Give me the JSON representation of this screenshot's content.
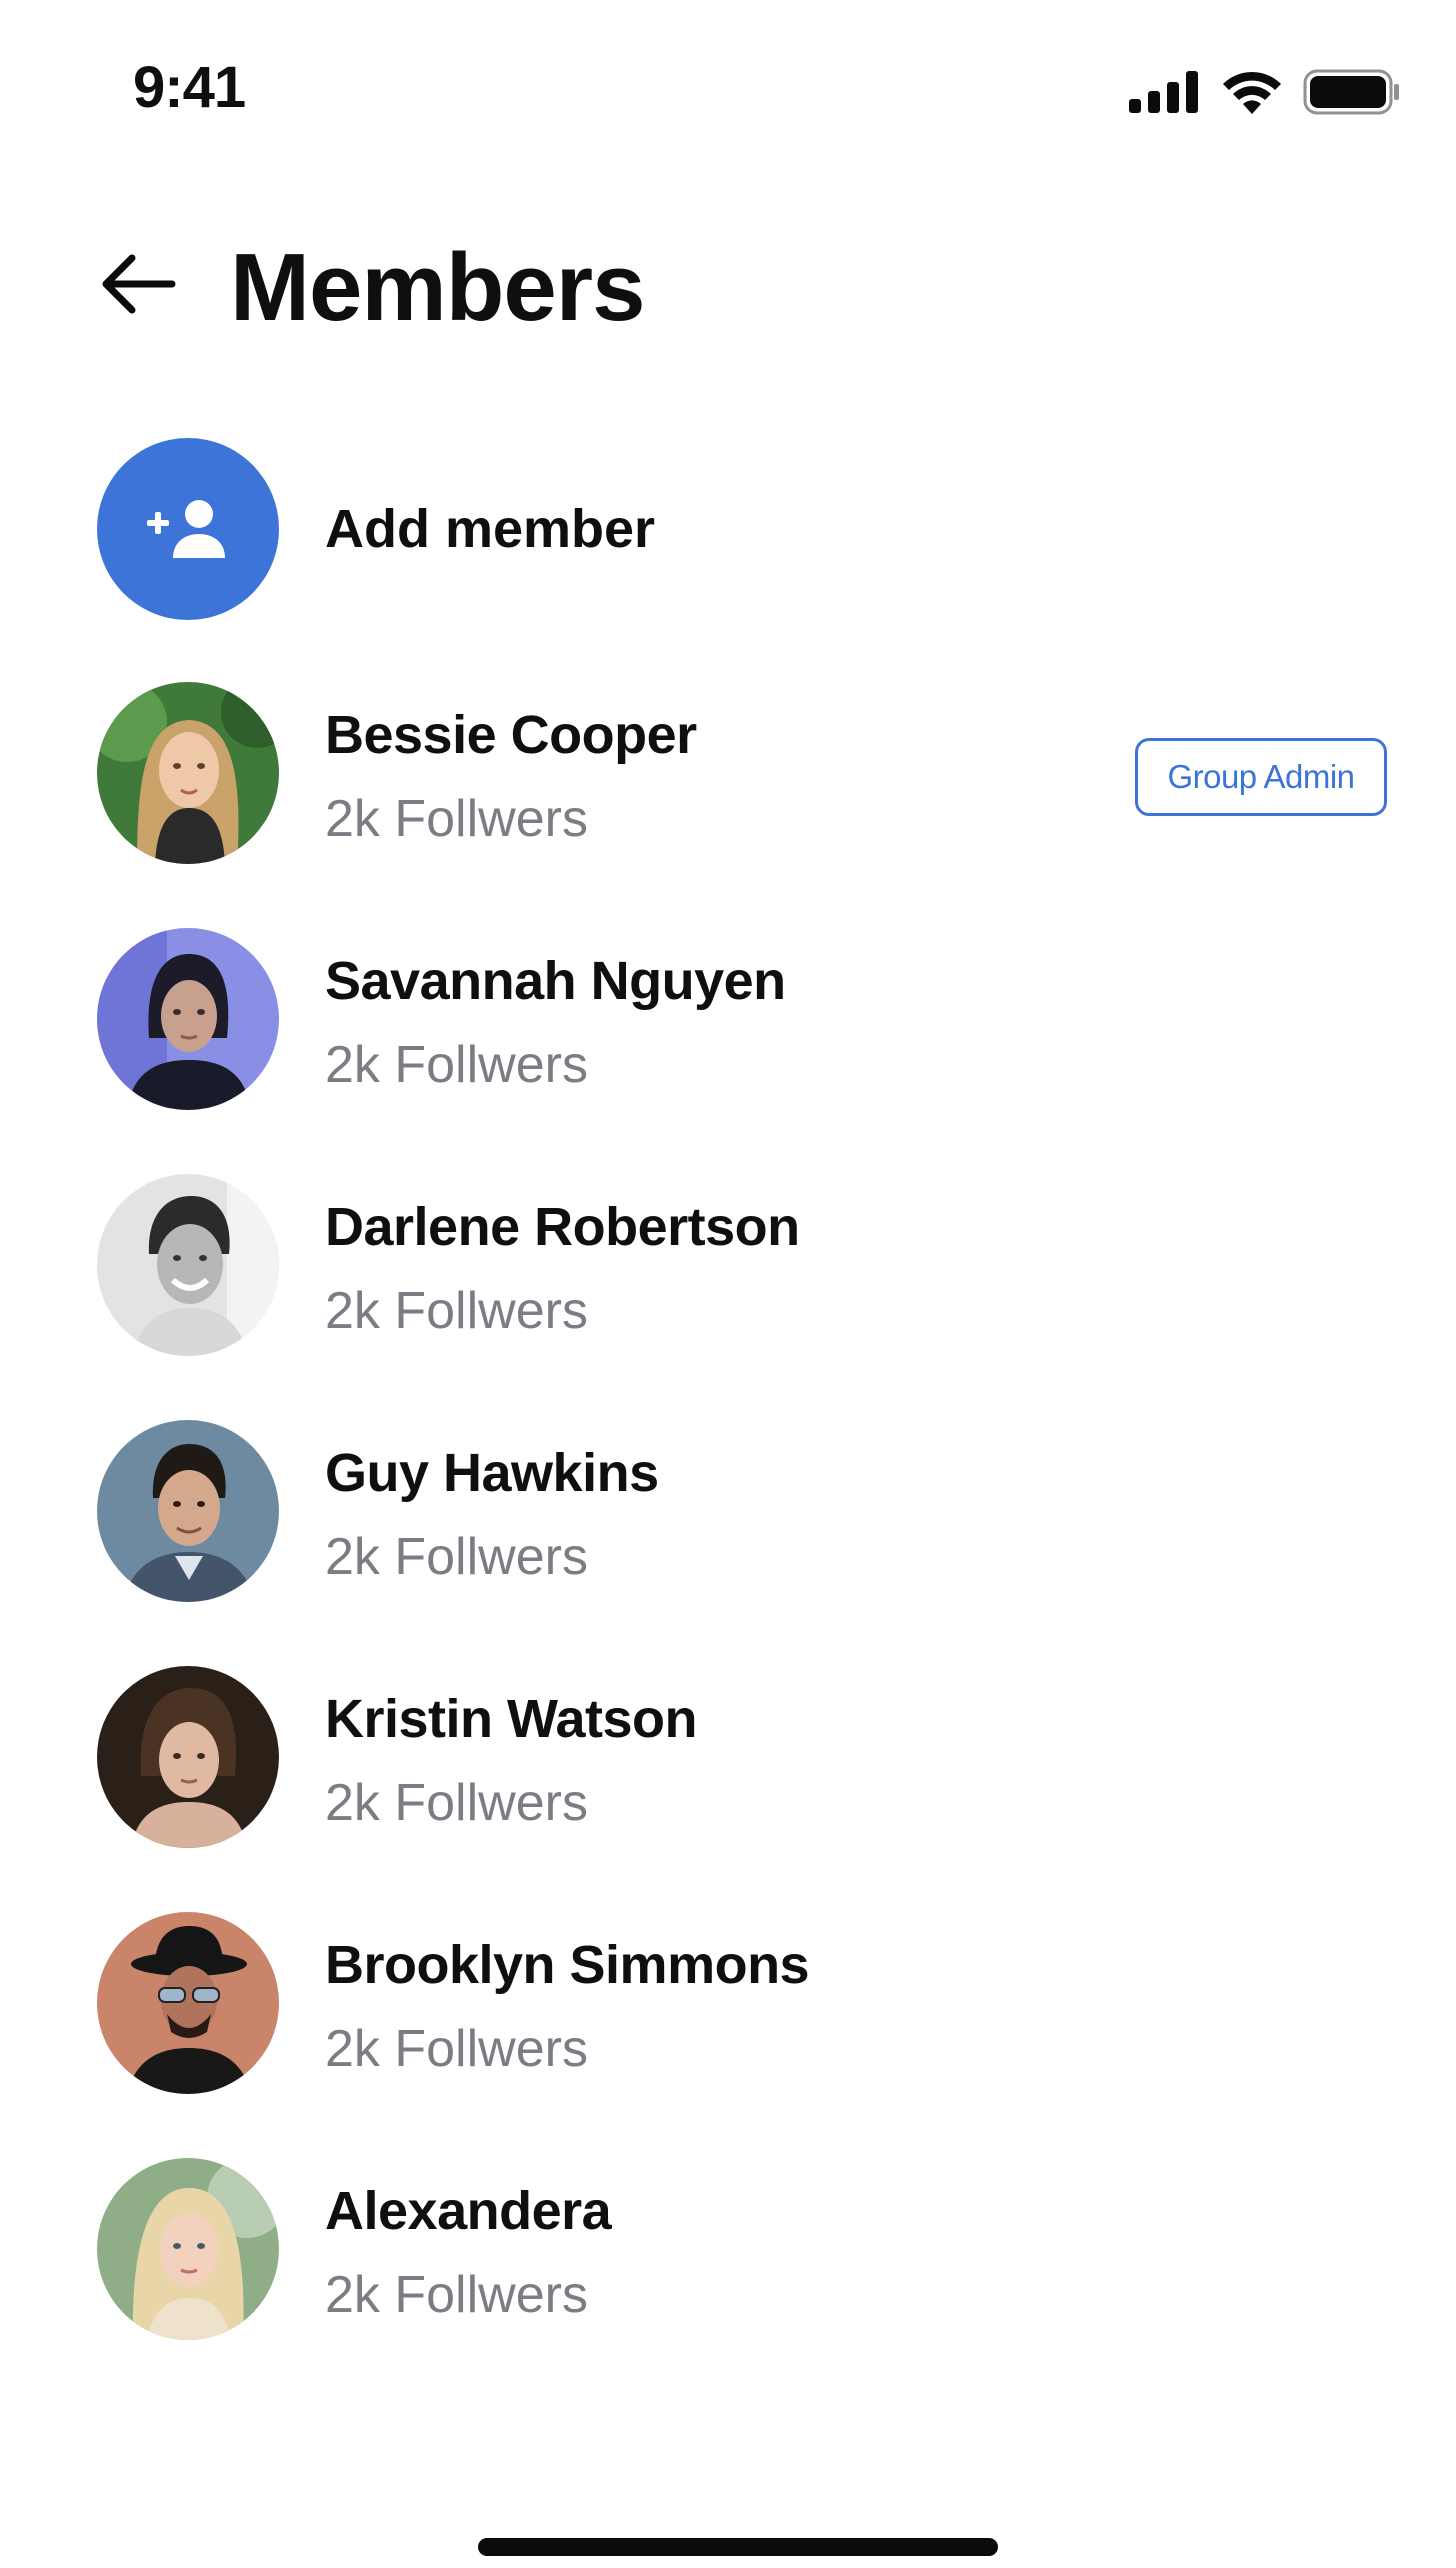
{
  "status_bar": {
    "time": "9:41",
    "icons": [
      "signal-icon",
      "wifi-icon",
      "battery-icon"
    ]
  },
  "header": {
    "back_icon": "arrow-left-icon",
    "title": "Members"
  },
  "add_member": {
    "label": "Add member",
    "icon": "add-user-icon",
    "color": "#3d74d8"
  },
  "members": [
    {
      "name": "Bessie Cooper",
      "followers": "2k Follwers",
      "badge": "Group Admin"
    },
    {
      "name": "Savannah Nguyen",
      "followers": "2k Follwers"
    },
    {
      "name": "Darlene Robertson",
      "followers": "2k Follwers"
    },
    {
      "name": "Guy Hawkins",
      "followers": "2k Follwers"
    },
    {
      "name": "Kristin Watson",
      "followers": "2k Follwers"
    },
    {
      "name": "Brooklyn Simmons",
      "followers": "2k Follwers"
    },
    {
      "name": "Alexandera",
      "followers": "2k Follwers"
    }
  ],
  "colors": {
    "accent": "#3d74d8",
    "text_primary": "#0f0f10",
    "text_secondary": "#7b7d85"
  }
}
